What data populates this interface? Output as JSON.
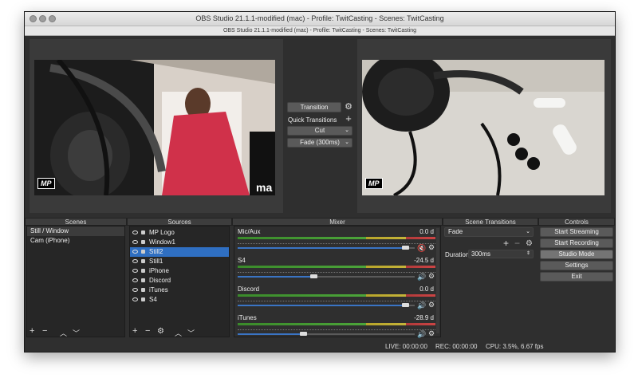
{
  "window": {
    "title": "OBS Studio 21.1.1-modified (mac) - Profile: TwitCasting - Scenes: TwitCasting",
    "subtitle": "OBS Studio 21.1.1-modified (mac) - Profile: TwitCasting - Scenes: TwitCasting"
  },
  "preview": {
    "left_badge": "MP",
    "right_badge": "MP",
    "left_logo_text": "ma"
  },
  "transition": {
    "button": "Transition",
    "quick_label": "Quick Transitions",
    "cut": "Cut",
    "fade": "Fade (300ms)"
  },
  "docks": {
    "scenes": "Scenes",
    "sources": "Sources",
    "mixer": "Mixer",
    "scene_transitions": "Scene Transitions",
    "controls": "Controls"
  },
  "scenes": [
    "Still / Window",
    "Cam (iPhone)"
  ],
  "sources": [
    {
      "name": "MP Logo",
      "selected": false
    },
    {
      "name": "Window1",
      "selected": false
    },
    {
      "name": "Still2",
      "selected": true
    },
    {
      "name": "Still1",
      "selected": false
    },
    {
      "name": "iPhone",
      "selected": false
    },
    {
      "name": "Discord",
      "selected": false
    },
    {
      "name": "iTunes",
      "selected": false
    },
    {
      "name": "S4",
      "selected": false
    }
  ],
  "mixer": [
    {
      "name": "Mic/Aux",
      "db": "0.0 d",
      "level": 0.93,
      "muted": true
    },
    {
      "name": "S4",
      "db": "-24.5 d",
      "level": 0.41,
      "muted": false
    },
    {
      "name": "Discord",
      "db": "0.0 d",
      "level": 0.93,
      "muted": false
    },
    {
      "name": "iTunes",
      "db": "-28.9 d",
      "level": 0.35,
      "muted": false
    }
  ],
  "scene_transitions": {
    "selected": "Fade",
    "duration_label": "Duration",
    "duration_value": "300ms"
  },
  "controls": {
    "start_streaming": "Start Streaming",
    "start_recording": "Start Recording",
    "studio_mode": "Studio Mode",
    "settings": "Settings",
    "exit": "Exit"
  },
  "status": {
    "live": "LIVE: 00:00:00",
    "rec": "REC: 00:00:00",
    "cpu": "CPU: 3.5%, 6.67 fps"
  },
  "colors": {
    "accent": "#2f6fc2",
    "window_bg": "#2f2f2f",
    "list_bg": "#262626"
  }
}
